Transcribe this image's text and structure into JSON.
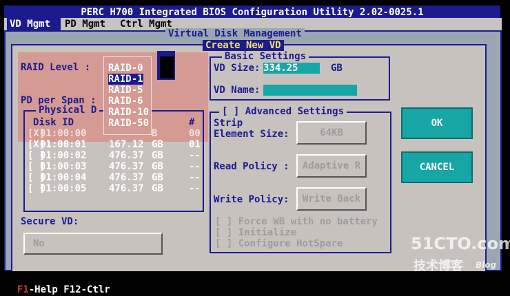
{
  "app": {
    "title": "PERC H700 Integrated BIOS Configuration Utility 2.02-0025.1"
  },
  "menu": {
    "items": [
      "VD Mgmt",
      "PD Mgmt",
      "Ctrl Mgmt"
    ]
  },
  "vd_panel": {
    "title": "Virtual Disk Management"
  },
  "create_panel": {
    "title": "Create New VD"
  },
  "raid": {
    "label": "RAID Level :",
    "options": [
      "RAID-0",
      "RAID-1",
      "RAID-5",
      "RAID-6",
      "RAID-10",
      "RAID-50"
    ],
    "selected": "RAID-1"
  },
  "pd_span": {
    "label": "PD per Span :"
  },
  "physical_disks": {
    "title": "Physical D",
    "col_disk": "Disk ID",
    "col_num": "#",
    "rows": [
      {
        "check": "[X]",
        "id": "01:00:00",
        "size": "",
        "unit": "B",
        "num": "00"
      },
      {
        "check": "[X]",
        "id": "01:00:01",
        "size": "167.12",
        "unit": "GB",
        "num": "01"
      },
      {
        "check": "[ ]",
        "id": "01:00:02",
        "size": "476.37",
        "unit": "GB",
        "num": "--"
      },
      {
        "check": "[ ]",
        "id": "01:00:03",
        "size": "476.37",
        "unit": "GB",
        "num": "--"
      },
      {
        "check": "[ ]",
        "id": "01:00:04",
        "size": "476.37",
        "unit": "GB",
        "num": "--"
      },
      {
        "check": "[ ]",
        "id": "01:00:05",
        "size": "476.37",
        "unit": "GB",
        "num": "--"
      }
    ]
  },
  "basic": {
    "title": "Basic Settings",
    "vd_size_label": "VD Size:",
    "vd_size_value": "334.25",
    "vd_size_unit": "GB",
    "vd_name_label": "VD Name:",
    "vd_name_value": ""
  },
  "advanced": {
    "title": "[ ] Advanced Settings",
    "strip_label_1": "Strip",
    "strip_label_2": "Element Size:",
    "strip_value": "64KB",
    "read_label": "Read Policy :",
    "read_value": "Adaptive R",
    "write_label": "Write Policy:",
    "write_value": "Write Back",
    "opt_force": "[ ] Force WB with no battery",
    "opt_init": "[ ] Initialize",
    "opt_hotspare": "[ ] Configure HotSpare"
  },
  "secure": {
    "label": "Secure VD:",
    "value": "No"
  },
  "buttons": {
    "ok": "OK",
    "cancel": "CANCEL"
  },
  "status": {
    "f1": "F1",
    "rest": "-Help F12-Ctlr"
  },
  "watermark": {
    "site": "51CTO.com",
    "sub": "技术博客",
    "blog": "Blog"
  }
}
